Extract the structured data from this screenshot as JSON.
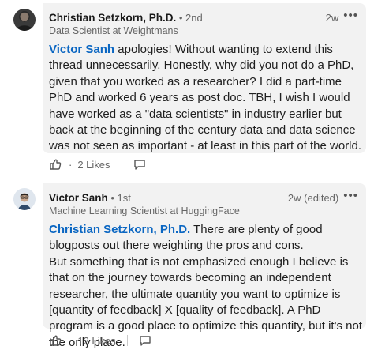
{
  "comments": [
    {
      "author": "Christian Setzkorn, Ph.D.",
      "degree": " • 2nd",
      "headline": "Data Scientist at Weightmans",
      "time": "2w",
      "more_label": "•••",
      "mention": "Victor Sanh",
      "text": " apologies! Without wanting to extend this thread unnecessarily. Honestly, why did you not do a PhD, given that you worked as a researcher? I did a part-time PhD and worked 6 years as post doc. TBH, I wish I would have worked as a \"data scientists\" in industry earlier but back at the beginning of the century data and data science was not seen as important - at least in this part of the world.",
      "likes_separator": "·",
      "likes": "2 Likes"
    },
    {
      "author": "Victor Sanh",
      "degree": " • 1st",
      "headline": "Machine Learning Scientist at HuggingFace",
      "time": "2w (edited)",
      "more_label": "•••",
      "mention": "Christian Setzkorn, Ph.D.",
      "text": " There are plenty of good blogposts out there weighting the pros and cons.",
      "text2": "But something that is not emphasized enough I believe is that on the journey towards becoming an independent researcher, the ultimate quantity you want to optimize is [quantity of feedback] X [quality of feedback]. A PhD program is a good place to optimize this quantity, but it's not the only place.",
      "likes_separator": "·",
      "likes": "13 Likes"
    }
  ],
  "icons": {
    "like": "thumbs-up-icon",
    "reply": "reply-icon"
  },
  "colors": {
    "mention": "#0a66c2",
    "bubble": "#f2f2f2",
    "secondary_text": "#666666"
  }
}
